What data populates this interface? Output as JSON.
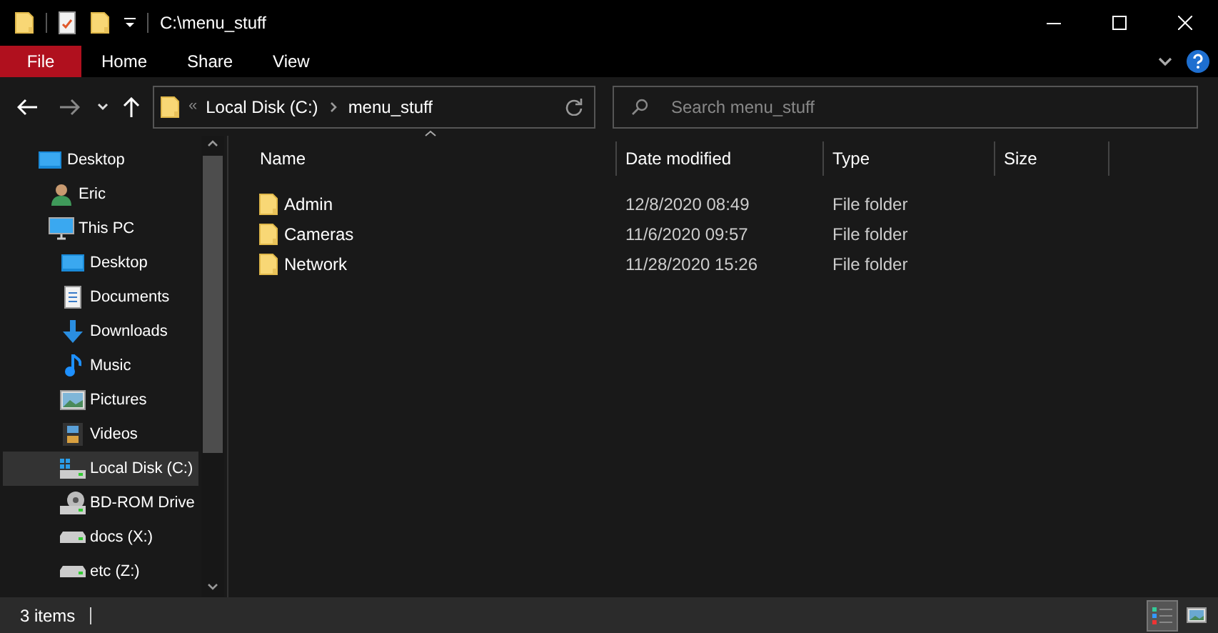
{
  "window": {
    "title": "C:\\menu_stuff"
  },
  "ribbon_tabs": [
    {
      "label": "File",
      "selected": true
    },
    {
      "label": "Home",
      "selected": false
    },
    {
      "label": "Share",
      "selected": false
    },
    {
      "label": "View",
      "selected": false
    }
  ],
  "address_bar": {
    "overflow": "«",
    "segments": [
      "Local Disk (C:)",
      "menu_stuff"
    ]
  },
  "search": {
    "placeholder": "Search menu_stuff"
  },
  "sidebar": {
    "items": [
      {
        "label": "Desktop",
        "kind": "desktop",
        "selected": false,
        "children": [
          {
            "label": "Eric",
            "kind": "user",
            "selected": false
          },
          {
            "label": "This PC",
            "kind": "pc",
            "selected": false,
            "children": [
              {
                "label": "Desktop",
                "kind": "desktop",
                "selected": false
              },
              {
                "label": "Documents",
                "kind": "document",
                "selected": false
              },
              {
                "label": "Downloads",
                "kind": "download",
                "selected": false
              },
              {
                "label": "Music",
                "kind": "music",
                "selected": false
              },
              {
                "label": "Pictures",
                "kind": "pictures",
                "selected": false
              },
              {
                "label": "Videos",
                "kind": "videos",
                "selected": false
              },
              {
                "label": "Local Disk (C:)",
                "kind": "system-drive",
                "selected": true
              },
              {
                "label": "BD-ROM Drive",
                "kind": "disc-drive",
                "selected": false
              },
              {
                "label": "docs (X:)",
                "kind": "drive",
                "selected": false
              },
              {
                "label": "etc (Z:)",
                "kind": "drive",
                "selected": false
              }
            ]
          }
        ]
      }
    ]
  },
  "table": {
    "columns": [
      "Name",
      "Date modified",
      "Type",
      "Size"
    ],
    "rows": [
      {
        "name": "Admin",
        "date_modified": "12/8/2020 08:49",
        "type": "File folder"
      },
      {
        "name": "Cameras",
        "date_modified": "11/6/2020 09:57",
        "type": "File folder"
      },
      {
        "name": "Network",
        "date_modified": "11/28/2020 15:26",
        "type": "File folder"
      }
    ]
  },
  "status_bar": {
    "item_count": "3 items",
    "views": [
      {
        "kind": "details",
        "selected": true
      },
      {
        "kind": "large-icons",
        "selected": false
      }
    ]
  }
}
